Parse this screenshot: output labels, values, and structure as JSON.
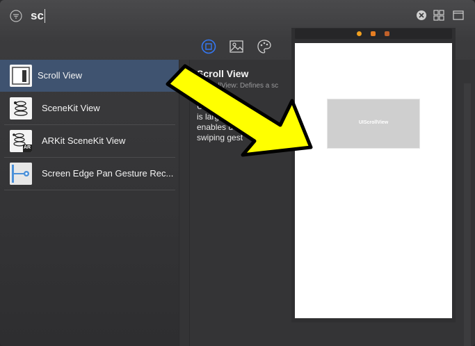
{
  "search": {
    "query": "sc",
    "icons": [
      "filter-icon",
      "clear-icon",
      "grid-view-icon",
      "panel-icon"
    ]
  },
  "tabs": [
    {
      "name": "objects",
      "icon": "square-icon",
      "selected": true
    },
    {
      "name": "media",
      "icon": "image-icon",
      "selected": false
    },
    {
      "name": "colors",
      "icon": "palette-icon",
      "selected": false
    }
  ],
  "list": {
    "items": [
      {
        "label": "Scroll View",
        "icon": "scroll-view-icon",
        "selected": true
      },
      {
        "label": "SceneKit View",
        "icon": "scenekit-icon",
        "selected": false
      },
      {
        "label": "ARKit SceneKit View",
        "icon": "arkit-icon",
        "badge": "AR",
        "selected": false
      },
      {
        "label": "Screen Edge Pan Gesture Rec...",
        "icon": "gesture-icon",
        "selected": false
      }
    ]
  },
  "detail": {
    "title": "Scroll View",
    "subtitle": "UIScrollView: Defines a sc",
    "lines": [
      "U... ...w pro",
      "is large",
      "enables user",
      "swiping gest"
    ]
  },
  "canvas": {
    "view_label": "UIScrollView"
  },
  "colors": {
    "accent": "#3478f6",
    "selection": "#3f5370",
    "annotation_arrow": "#ffff00"
  }
}
